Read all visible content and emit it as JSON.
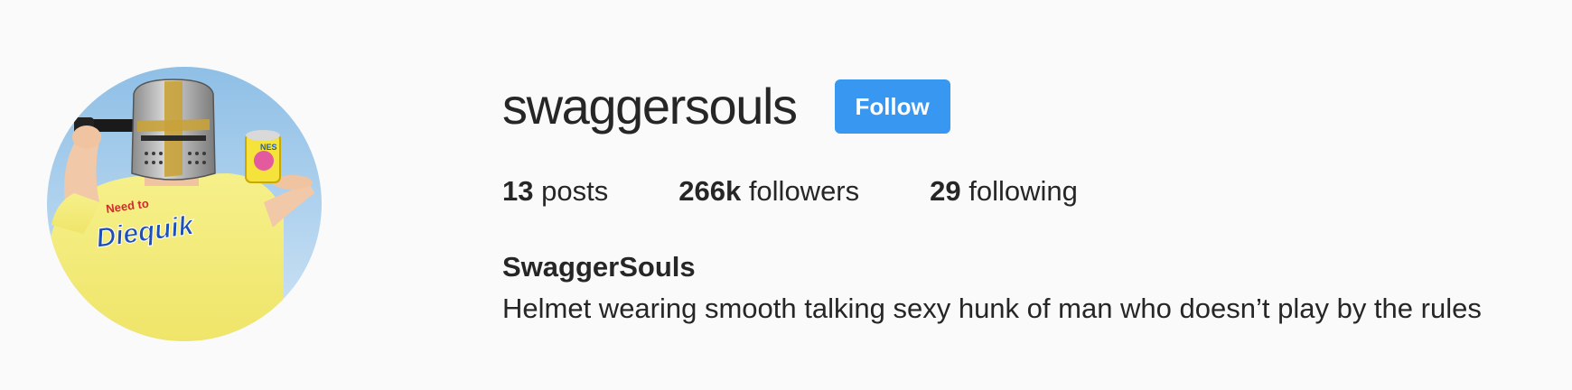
{
  "profile": {
    "username": "swaggersouls",
    "follow_label": "Follow",
    "full_name": "SwaggerSouls",
    "bio": "Helmet wearing smooth talking sexy hunk of man who doesn’t play by the rules",
    "stats": {
      "posts_count": "13",
      "posts_label": "posts",
      "followers_count": "266k",
      "followers_label": "followers",
      "following_count": "29",
      "following_label": "following"
    },
    "avatar": {
      "shirt_text_small": "Need to",
      "shirt_text_large": "Diequik",
      "can_text": "NES"
    }
  },
  "colors": {
    "background": "#fafafa",
    "text": "#262626",
    "follow_button": "#3897f0",
    "follow_button_text": "#ffffff"
  }
}
